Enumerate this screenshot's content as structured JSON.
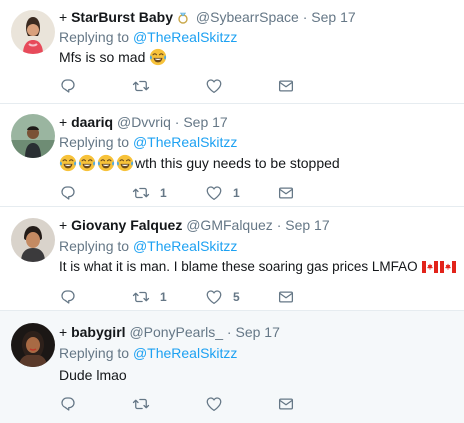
{
  "tweets": [
    {
      "name": "StarBurst Baby",
      "handle": "@SybearrSpace",
      "date": "Sep 17",
      "replying_prefix": "Replying to",
      "replying_to": "@TheRealSkitzz",
      "text": "Mfs is so mad",
      "replies": "",
      "retweets": "",
      "likes": ""
    },
    {
      "name": "daariq",
      "handle": "@Dvvriq",
      "date": "Sep 17",
      "replying_prefix": "Replying to",
      "replying_to": "@TheRealSkitzz",
      "text": "wth this guy needs to be stopped",
      "replies": "",
      "retweets": "1",
      "likes": "1"
    },
    {
      "name": "Giovany Falquez",
      "handle": "@GMFalquez",
      "date": "Sep 17",
      "replying_prefix": "Replying to",
      "replying_to": "@TheRealSkitzz",
      "text": "It is what it is man. I blame these soaring gas prices LMFAO",
      "replies": "",
      "retweets": "1",
      "likes": "5"
    },
    {
      "name": "babygirl",
      "handle": "@PonyPearls_",
      "date": "Sep 17",
      "replying_prefix": "Replying to",
      "replying_to": "@TheRealSkitzz",
      "text": "Dude lmao",
      "replies": "",
      "retweets": "",
      "likes": ""
    }
  ],
  "separator": "·",
  "plus": "+",
  "colors": {
    "link": "#1da1f2",
    "muted": "#657786",
    "text": "#14171a",
    "divider": "#e6ecf0",
    "highlight_bg": "#f5f8fa"
  },
  "icons": {
    "reply": "reply-icon",
    "retweet": "retweet-icon",
    "like": "heart-icon",
    "dm": "envelope-icon",
    "badge": "diamond-ring-icon",
    "emoji": "tears-of-joy-emoji",
    "flag": "canada-flag"
  }
}
